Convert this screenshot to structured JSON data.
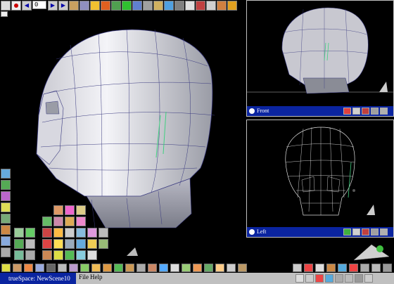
{
  "toolbar": {
    "frame_value": "0"
  },
  "viewports": {
    "front": {
      "label": "Front"
    },
    "left": {
      "label": "Left"
    }
  },
  "status": {
    "app_title": "trueSpace: NewScene10",
    "menu": [
      "File",
      "Help"
    ]
  },
  "colors": {
    "title_bar": "#0a24a0",
    "mesh_light": "#e8e8ee",
    "mesh_dark": "#8a8c96",
    "wire": "#3a3a80",
    "selection": "#40d080"
  }
}
